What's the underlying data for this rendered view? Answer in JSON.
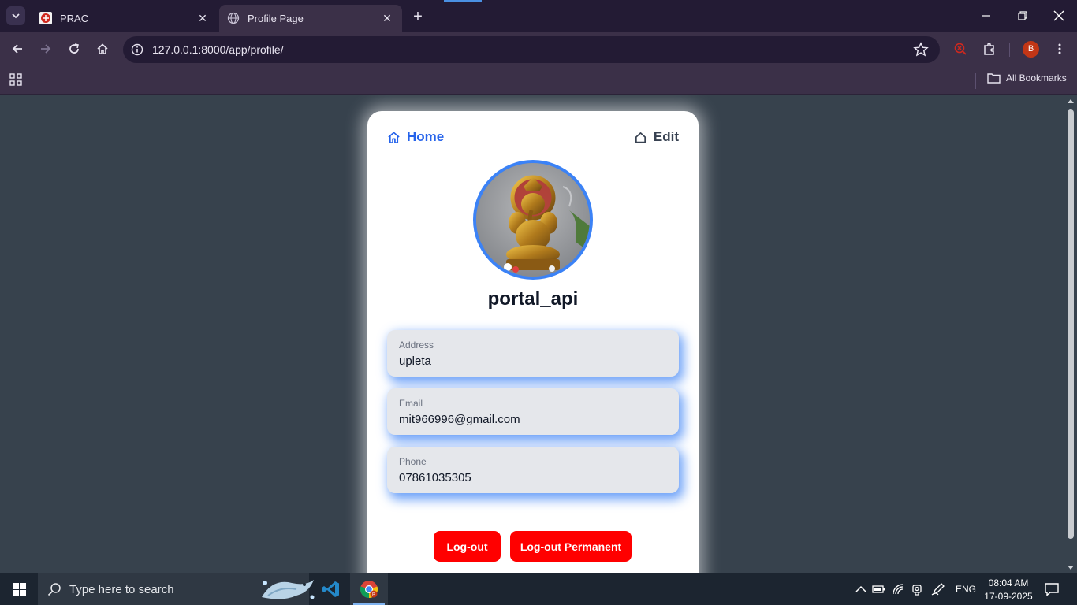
{
  "browser": {
    "tabs": [
      {
        "title": "PRAC",
        "active": false
      },
      {
        "title": "Profile Page",
        "active": true
      }
    ],
    "url": "127.0.0.1:8000/app/profile/",
    "profile_initial": "B",
    "bookmarks_label": "All Bookmarks"
  },
  "nav": {
    "home_label": "Home",
    "edit_label": "Edit"
  },
  "profile": {
    "username": "portal_api",
    "fields": [
      {
        "label": "Address",
        "value": "upleta"
      },
      {
        "label": "Email",
        "value": "mit966996@gmail.com"
      },
      {
        "label": "Phone",
        "value": "07861035305"
      }
    ]
  },
  "actions": {
    "logout_label": "Log-out",
    "logout_permanent_label": "Log-out Permanent"
  },
  "colors": {
    "accent": "#2563eb",
    "avatar_border": "#3b82f6",
    "danger": "#ff0000",
    "page_bg": "#37424d"
  },
  "taskbar": {
    "search_placeholder": "Type here to search",
    "language": "ENG",
    "time": "08:04 AM",
    "date": "17-09-2025"
  }
}
